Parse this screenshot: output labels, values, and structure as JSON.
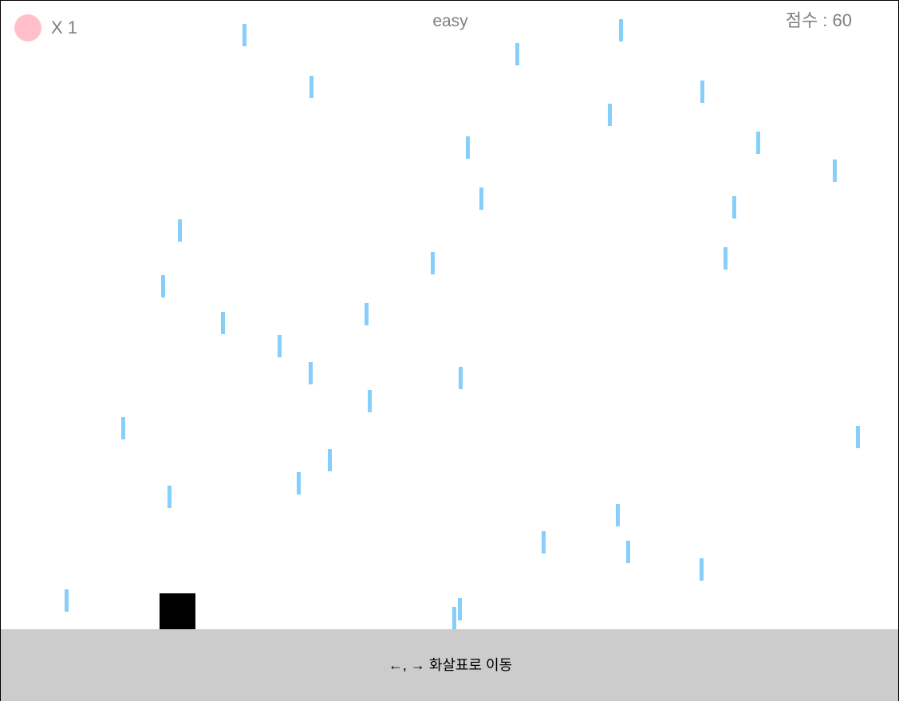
{
  "hud": {
    "lives_label": "X 1",
    "difficulty": "easy",
    "score_label": "점수 : 60"
  },
  "instructions": "←, → 화살표로 이동",
  "colors": {
    "raindrop": "#87cefa",
    "life_icon": "#ffc0cb",
    "player": "#000000",
    "ground": "#cccccc",
    "hud_text": "#7f7f7f"
  },
  "icons": {
    "life": "pink-circle-icon",
    "player": "black-square"
  }
}
